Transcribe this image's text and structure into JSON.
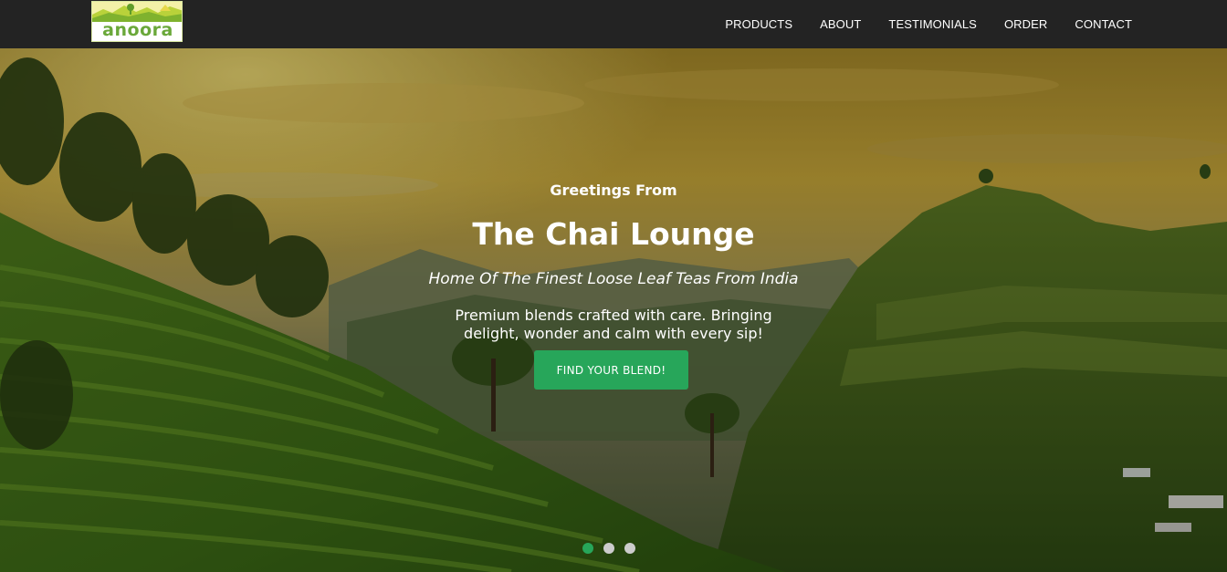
{
  "brand": {
    "logo_text": "anoora"
  },
  "nav": {
    "items": [
      {
        "label": "PRODUCTS"
      },
      {
        "label": "ABOUT"
      },
      {
        "label": "TESTIMONIALS"
      },
      {
        "label": "ORDER"
      },
      {
        "label": "CONTACT"
      }
    ]
  },
  "hero": {
    "greeting": "Greetings From",
    "title": "The Chai Lounge",
    "tagline": "Home Of The Finest Loose Leaf Teas From India",
    "description": "Premium blends crafted with care. Bringing delight, wonder and calm with every sip!",
    "cta_label": "FIND YOUR BLEND!"
  },
  "carousel": {
    "slide_count": 3,
    "active_index": 0
  },
  "colors": {
    "accent": "#27a65a",
    "navbar": "#232323",
    "logo_green": "#6aa83a"
  }
}
